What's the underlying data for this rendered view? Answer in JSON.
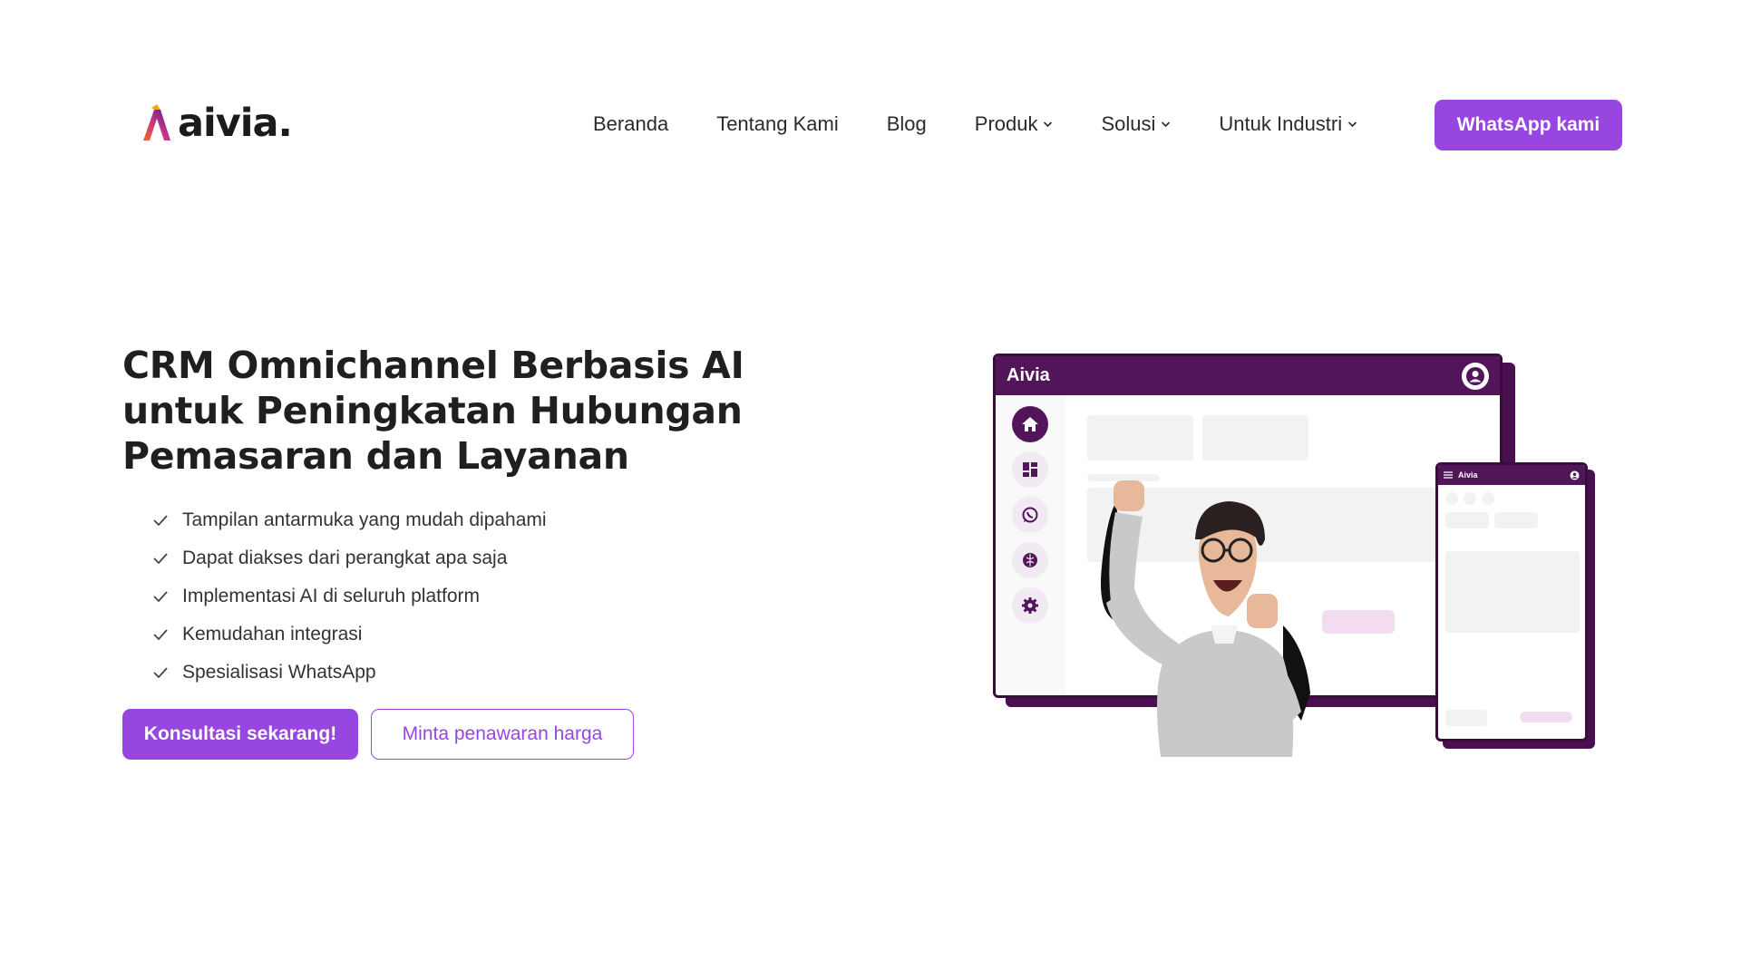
{
  "brand": {
    "name": "aivia.",
    "accent": "#9747e0",
    "dark": "#53155a"
  },
  "nav": {
    "items": [
      {
        "label": "Beranda",
        "has_dropdown": false
      },
      {
        "label": "Tentang Kami",
        "has_dropdown": false
      },
      {
        "label": "Blog",
        "has_dropdown": false
      },
      {
        "label": "Produk",
        "has_dropdown": true
      },
      {
        "label": "Solusi",
        "has_dropdown": true
      },
      {
        "label": "Untuk Industri",
        "has_dropdown": true
      }
    ],
    "cta_label": "WhatsApp kami"
  },
  "hero": {
    "title_line1": "CRM Omnichannel Berbasis AI",
    "title_line2": "untuk Peningkatan Hubungan",
    "title_line3": "Pemasaran dan Layanan",
    "features": [
      "Tampilan antarmuka yang mudah dipahami",
      "Dapat diakses dari perangkat apa saja",
      "Implementasi AI di seluruh platform",
      "Kemudahan integrasi",
      "Spesialisasi WhatsApp"
    ],
    "primary_button": "Konsultasi sekarang!",
    "secondary_button": "Minta penawaran harga"
  },
  "illustration": {
    "window_title": "Aivia",
    "phone_title": "Aivia",
    "sidebar_icons": [
      "home-icon",
      "dashboard-icon",
      "whatsapp-icon",
      "ai-brain-icon",
      "settings-icon"
    ]
  }
}
